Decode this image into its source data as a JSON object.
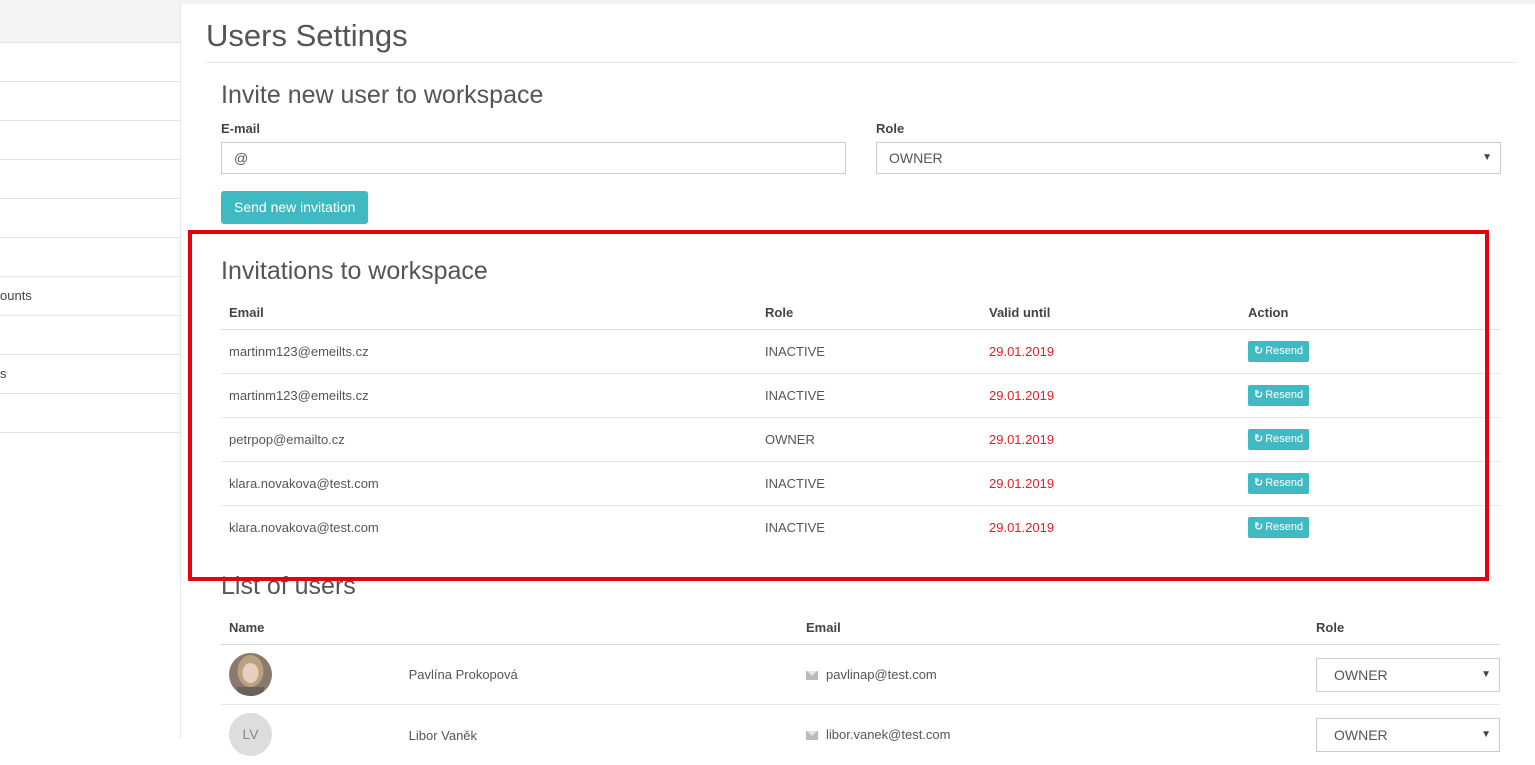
{
  "sidebar": {
    "items": [
      {
        "label": ""
      },
      {
        "label": ""
      },
      {
        "label": ""
      },
      {
        "label": ""
      },
      {
        "label": ""
      },
      {
        "label": ""
      },
      {
        "label": "ounts"
      },
      {
        "label": ""
      },
      {
        "label": "s"
      },
      {
        "label": ""
      }
    ]
  },
  "page": {
    "title": "Users Settings"
  },
  "invite": {
    "title": "Invite new user to workspace",
    "email_label": "E-mail",
    "email_value": "@",
    "role_label": "Role",
    "role_value": "OWNER",
    "send_button": "Send new invitation"
  },
  "invitations": {
    "title": "Invitations to workspace",
    "columns": [
      "Email",
      "Role",
      "Valid until",
      "Action"
    ],
    "resend_label": "Resend",
    "rows": [
      {
        "email": "martinm123@emeilts.cz",
        "role": "INACTIVE",
        "valid_until": "29.01.2019"
      },
      {
        "email": "martinm123@emeilts.cz",
        "role": "INACTIVE",
        "valid_until": "29.01.2019"
      },
      {
        "email": "petrpop@emailto.cz",
        "role": "OWNER",
        "valid_until": "29.01.2019"
      },
      {
        "email": "klara.novakova@test.com",
        "role": "INACTIVE",
        "valid_until": "29.01.2019"
      },
      {
        "email": "klara.novakova@test.com",
        "role": "INACTIVE",
        "valid_until": "29.01.2019"
      }
    ]
  },
  "users": {
    "title": "List of users",
    "columns": [
      "Name",
      "Email",
      "Role"
    ],
    "rows": [
      {
        "initials": "",
        "name": "Pavlína Prokopová",
        "email": "pavlinap@test.com",
        "role": "OWNER"
      },
      {
        "initials": "LV",
        "name": "Libor Vaněk",
        "email": "libor.vanek@test.com",
        "role": "OWNER"
      }
    ]
  },
  "colors": {
    "accent": "#3fbac2",
    "date_red": "#e41e26",
    "highlight": "#e8000b"
  }
}
